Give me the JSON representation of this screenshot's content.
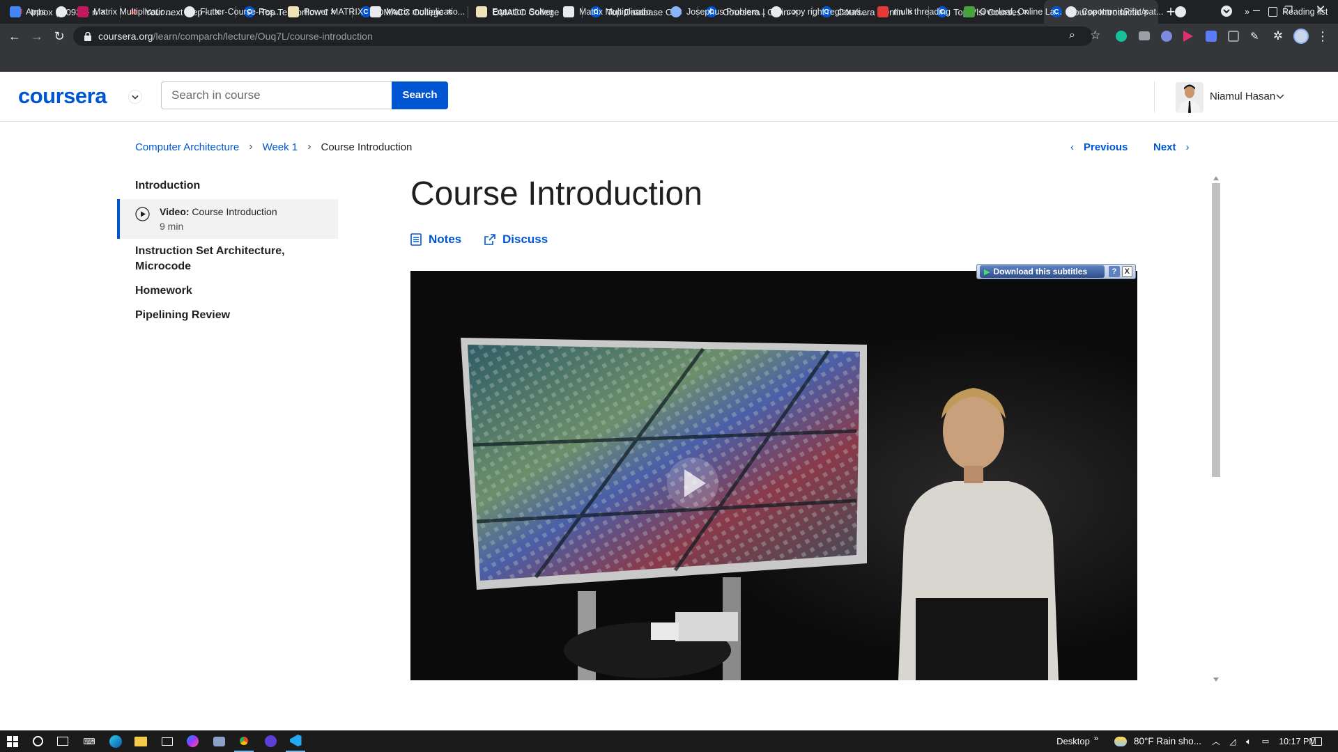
{
  "browser": {
    "tabs": [
      {
        "title": "Inbox (2,093) - niam",
        "icon": "gmail-icon",
        "color": "#ea4335",
        "active": false
      },
      {
        "title": "Your next step - 17",
        "icon": "gmail-icon",
        "color": "#ea4335",
        "active": false
      },
      {
        "title": "Top Tensorflow Co",
        "icon": "coursera-icon",
        "color": "#0056d2",
        "active": false
      },
      {
        "title": "DMACC College on",
        "icon": "coursera-icon",
        "color": "#0056d2",
        "active": false
      },
      {
        "title": "DMACC College on",
        "icon": "coursera-icon",
        "color": "#0056d2",
        "active": false
      },
      {
        "title": "Top Database Cour",
        "icon": "coursera-icon",
        "color": "#0056d2",
        "active": false
      },
      {
        "title": "Coursera | Online C",
        "icon": "coursera-icon",
        "color": "#0056d2",
        "active": false
      },
      {
        "title": "Coursera | Online C",
        "icon": "coursera-icon",
        "color": "#0056d2",
        "active": false
      },
      {
        "title": "Top Vlsi Courses - C",
        "icon": "coursera-icon",
        "color": "#0056d2",
        "active": false
      },
      {
        "title": "Course Introductio",
        "icon": "coursera-icon",
        "color": "#0056d2",
        "active": true
      }
    ],
    "url_domain": "coursera.org",
    "url_path": "/learn/comparch/lecture/Ouq7L/course-introduction",
    "bookmarks": [
      {
        "label": "Apps",
        "icon": "apps-grid-icon"
      },
      {
        "label": "",
        "icon": "globe-icon"
      },
      {
        "label": "Matrix Multiplicatio...",
        "icon": "matrix-icon"
      },
      {
        "label": "Flutter-Course-Res...",
        "icon": "github-icon"
      },
      {
        "label": "Power MATRIX",
        "icon": "folder-icon"
      },
      {
        "label": "Matrix multiplicatio...",
        "icon": "mathway-icon"
      },
      {
        "label": "Equation Solver",
        "icon": "folder-icon"
      },
      {
        "label": "Matrix Multiplicatio...",
        "icon": "r-icon"
      },
      {
        "label": "Josephus Problem...",
        "icon": "loading-icon"
      },
      {
        "label": "copy right registrati...",
        "icon": "globe-icon"
      },
      {
        "label": "multi threading",
        "icon": "d-icon"
      },
      {
        "label": "Overleaf, Online La...",
        "icon": "overleaf-icon"
      },
      {
        "label": "CopotronicRifat/pat...",
        "icon": "github-icon"
      },
      {
        "label": "",
        "icon": "globe-icon"
      }
    ],
    "overflow": "»",
    "reading_list": "Reading list"
  },
  "header": {
    "logo": "coursera",
    "search_placeholder": "Search in course",
    "search_button": "Search",
    "user_name": "Niamul Hasan"
  },
  "breadcrumb": {
    "course": "Computer Architecture",
    "week": "Week 1",
    "current": "Course Introduction"
  },
  "nav": {
    "previous": "Previous",
    "next": "Next"
  },
  "sidebar": {
    "sections": [
      {
        "label": "Introduction"
      },
      {
        "label": "Instruction Set Architecture, Microcode"
      },
      {
        "label": "Homework"
      },
      {
        "label": "Pipelining Review"
      }
    ],
    "active_item": {
      "type": "Video:",
      "title": "Course Introduction",
      "duration": "9 min"
    }
  },
  "main": {
    "title": "Course Introduction",
    "notes_label": "Notes",
    "discuss_label": "Discuss",
    "subtitle_button": "Download this subtitles",
    "subtitle_help": "?",
    "subtitle_close": "X"
  },
  "taskbar": {
    "desktop_label": "Desktop",
    "weather": "80°F  Rain sho...",
    "time": "10:17 PM"
  }
}
